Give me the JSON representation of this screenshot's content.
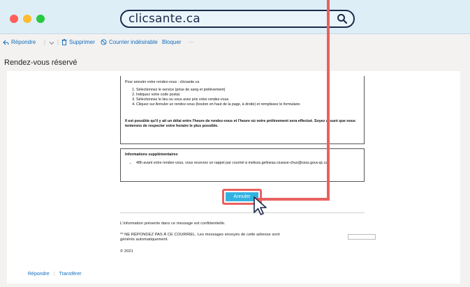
{
  "browser": {
    "url": "clicsante.ca",
    "icons": [
      "close-dot",
      "minimize-dot",
      "maximize-dot",
      "search-icon"
    ]
  },
  "toolbar": {
    "reply": "Répondre",
    "delete": "Supprimer",
    "junk": "Courrier indésirable",
    "block": "Bloquer",
    "more": "···"
  },
  "subject": "Rendez-vous réservé",
  "email": {
    "intro": "Pour annuler votre rendez-vous : clicsante.ca",
    "steps": [
      "Sélectionnez le service (prise de sang et prélèvement)",
      "Indiquez votre code postal.",
      "Sélectionnez le lieu ou vous avez pris votre rendez-vous.",
      "Cliquez sur Annuler un rendez-vous (bouton en haut de la page, à droite) et remplissez le formulaire."
    ],
    "warning": "Il est possible qu'il y ait un délai entre l'heure de rendez-vous et l'heure où votre prélèvement sera effectué. Soyez assuré que nous tenterons de respecter votre horaire le plus possible.",
    "info_heading": "Informations supplémentaires",
    "info_item": "48h avant votre rendez-vous, vous recevrez un rappel par courriel à melisss.gelineau.ciussse-chus@ssss.gouv.qc.ca",
    "cancel_button": "Annuler",
    "confidential": "L'information présente dans ce message est confidentielle.",
    "no_reply": "** NE RÉPONDEZ PAS À CE COURRIEL. Les messages envoyés de cette adresse sont générés automatiquement.",
    "copyright": "© 2021"
  },
  "actions": {
    "reply": "Répondre",
    "forward": "Transférer"
  },
  "colors": {
    "annotation": "#e8615f",
    "button": "#33b2e2",
    "link": "#0f6cbd"
  }
}
